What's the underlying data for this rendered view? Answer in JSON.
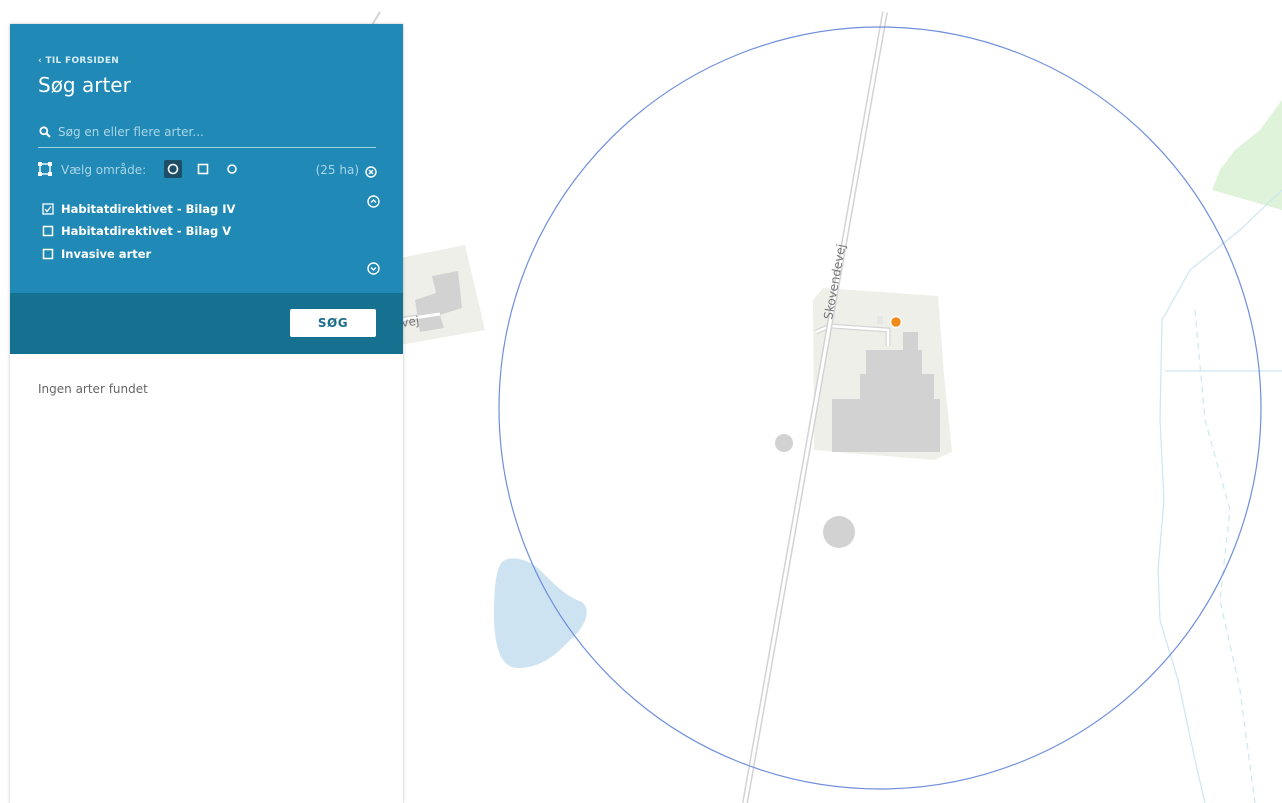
{
  "panel": {
    "back_label": "‹ TIL FORSIDEN",
    "title": "Søg arter",
    "search_placeholder": "Søg en eller flere arter...",
    "area_label": "Vælg område:",
    "area_size": "(25 ha)",
    "filters": [
      {
        "label": "Habitatdirektivet - Bilag IV",
        "checked": true
      },
      {
        "label": "Habitatdirektivet - Bilag V",
        "checked": false
      },
      {
        "label": "Invasive arter",
        "checked": false
      }
    ],
    "search_button": "SØG",
    "no_results": "Ingen arter fundet"
  },
  "map": {
    "road_label": "Skovendevej",
    "road_label_fragment": "vej"
  },
  "colors": {
    "panel_header": "#2089b5",
    "panel_footer": "#16708f",
    "circle_stroke": "#6f8fdc",
    "marker": "#f28a1a",
    "water": "#cde3f1",
    "forest": "#def3da"
  },
  "icons": {
    "search": "search-icon",
    "area": "polygon-select-icon",
    "clear": "clear-circle-icon",
    "collapse": "chevron-up-circle-icon",
    "expand": "chevron-down-circle-icon"
  }
}
